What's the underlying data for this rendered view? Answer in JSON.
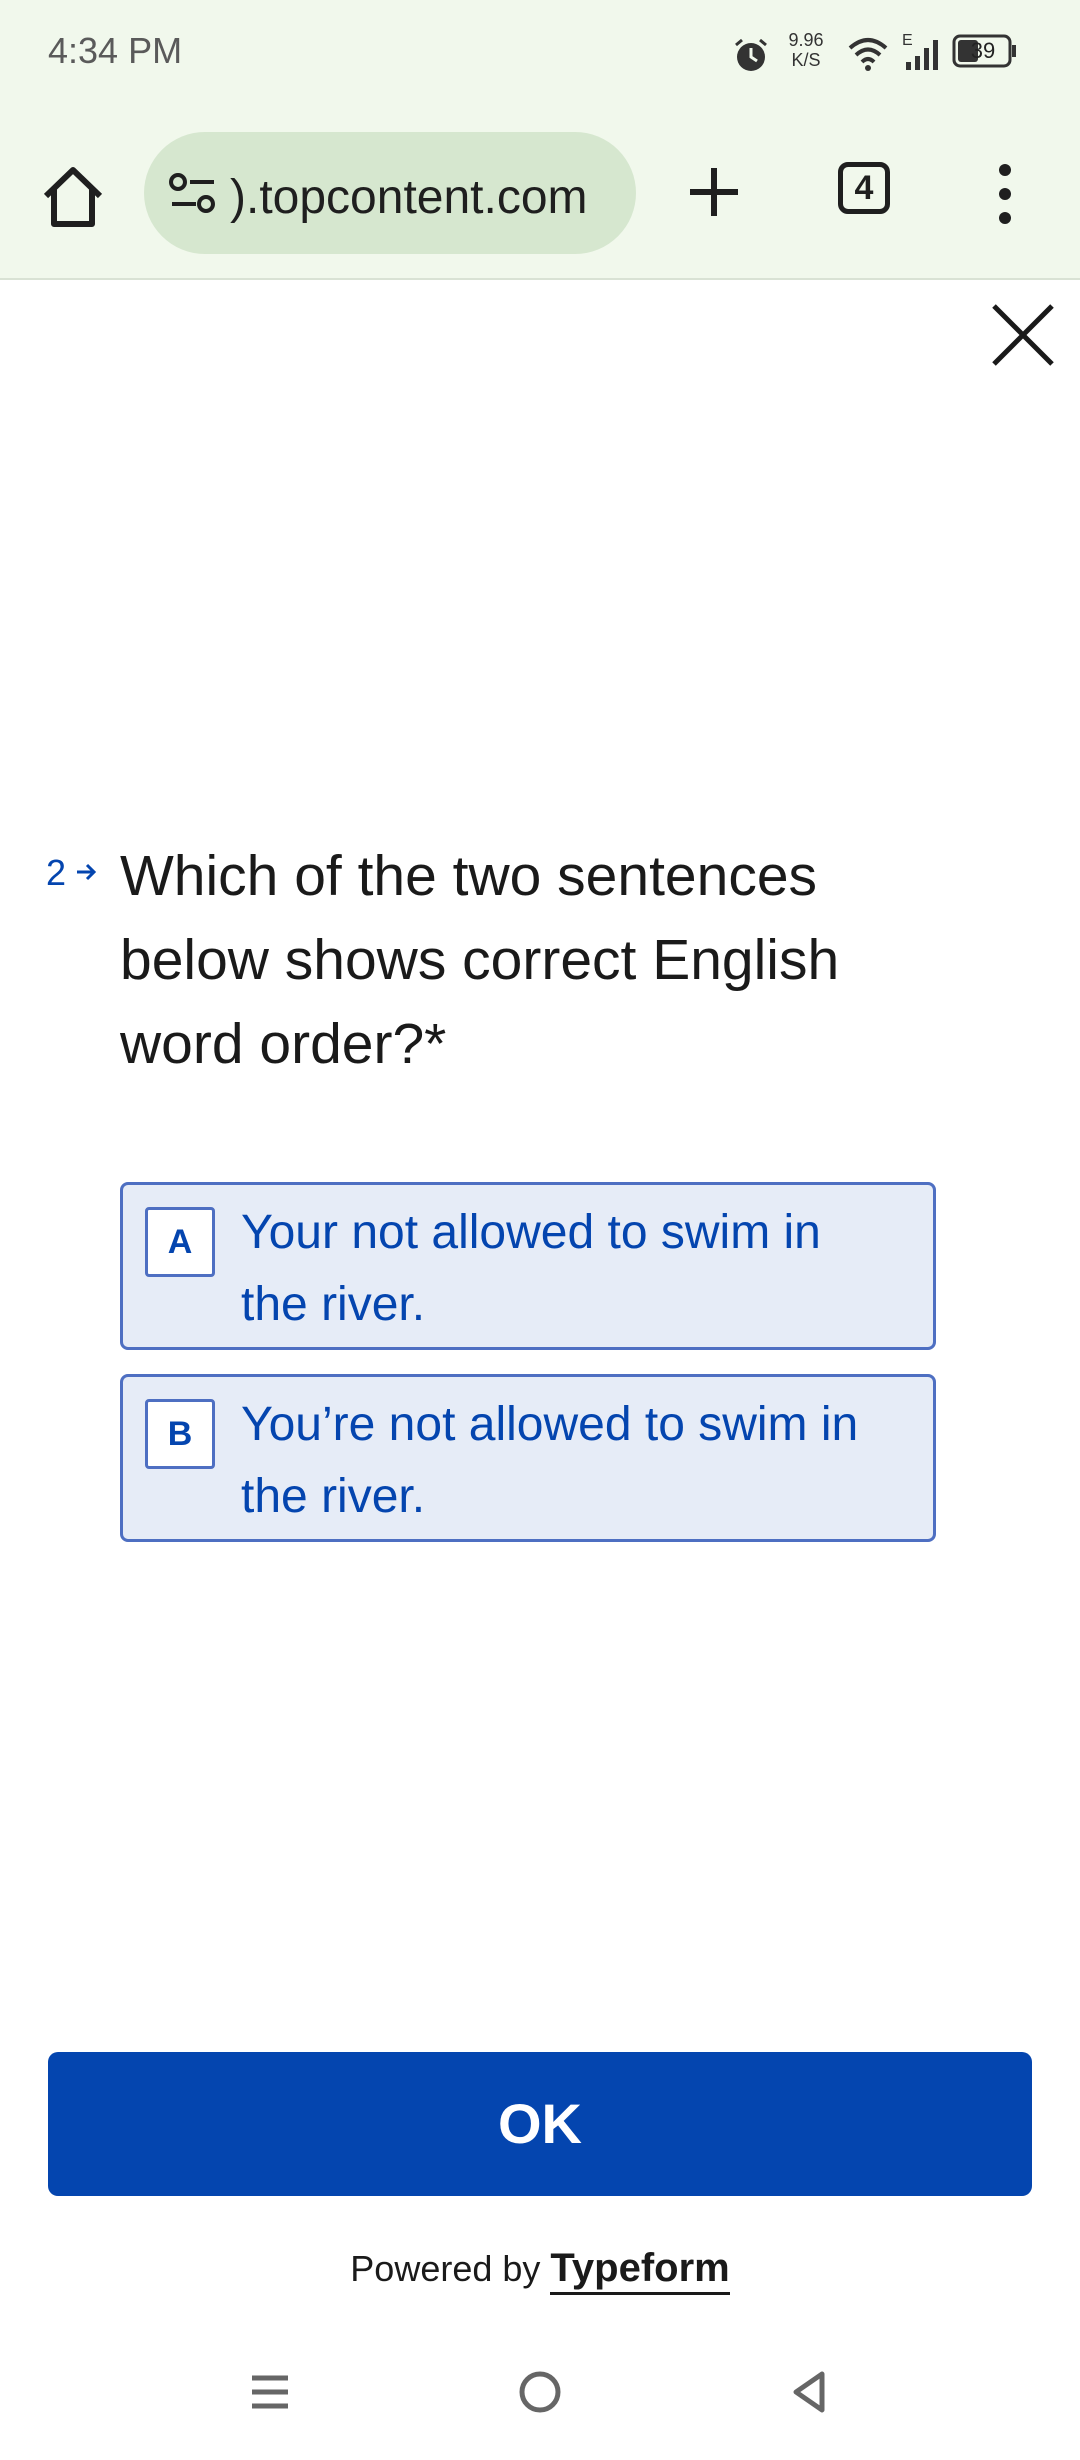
{
  "status_bar": {
    "time": "4:34 PM",
    "speed_value": "9.96",
    "speed_unit": "K/S",
    "network_type": "E",
    "battery": "39"
  },
  "browser": {
    "url": ").topcontent.com",
    "tab_count": "4"
  },
  "form": {
    "question_number": "2",
    "question_text": "Which of the two sentences below shows correct English word order?*",
    "choices": [
      {
        "key": "A",
        "text": "Your not allowed to swim in the river."
      },
      {
        "key": "B",
        "text": "You’re not allowed to swim in the river."
      }
    ],
    "ok_label": "OK",
    "powered_by": "Powered by",
    "brand": "Typeform",
    "accent_color": "#0445af"
  }
}
